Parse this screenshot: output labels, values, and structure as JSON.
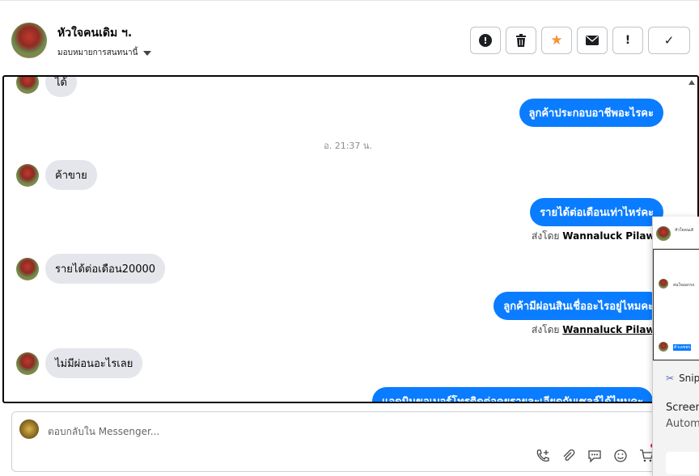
{
  "header": {
    "contact_name": "หัวใจคนเดิม ฯ.",
    "assign_label": "มอบหมายการสนทนานี้",
    "actions": [
      {
        "icon": "alert-circle-icon",
        "name": "mark-spam-button"
      },
      {
        "icon": "trash-icon",
        "name": "delete-button"
      },
      {
        "icon": "star-icon",
        "name": "star-button"
      },
      {
        "icon": "envelope-icon",
        "name": "mark-unread-button"
      },
      {
        "icon": "exclamation-icon",
        "name": "follow-up-button"
      },
      {
        "icon": "check-icon",
        "name": "mark-done-button"
      }
    ]
  },
  "colors": {
    "outgoing_bubble": "#0a7cff",
    "incoming_bubble": "#e4e6eb",
    "star": "#f7923a"
  },
  "messages": {
    "partial_top": "ได้",
    "out_1": "ลูกค้าประกอบอาชีพอะไรคะ",
    "timestamp_1": "อ. 21:37 น.",
    "in_1": "ค้าขาย",
    "out_2": "รายได้ต่อเดือนเท่าไหร่คะ",
    "sent_by_prefix": "ส่งโดย",
    "sent_by_name": "Wannaluck Pilawan",
    "in_2": "รายได้ต่อเดือน20000",
    "out_3": "ลูกค้ามีผ่อนสินเชื่ออะไรอยู่ไหมคะ",
    "in_3": "ไม่มีผ่อนอะไรเลย",
    "out_4": "แอดมินขอเบอร์โทรติดต่อคุยรายละเอียดกับเซลล์ได้ไหมคะ"
  },
  "composer": {
    "placeholder": "ตอบกลับใน Messenger..."
  },
  "popup": {
    "thumb_name": "หัวใจคนเดิ",
    "thumb_msg": "สนใจออกรถ",
    "thumb_selected": "ตัวเลขพร",
    "snip_app": "Snip",
    "toast_title": "Screen",
    "toast_sub": "Autom"
  }
}
